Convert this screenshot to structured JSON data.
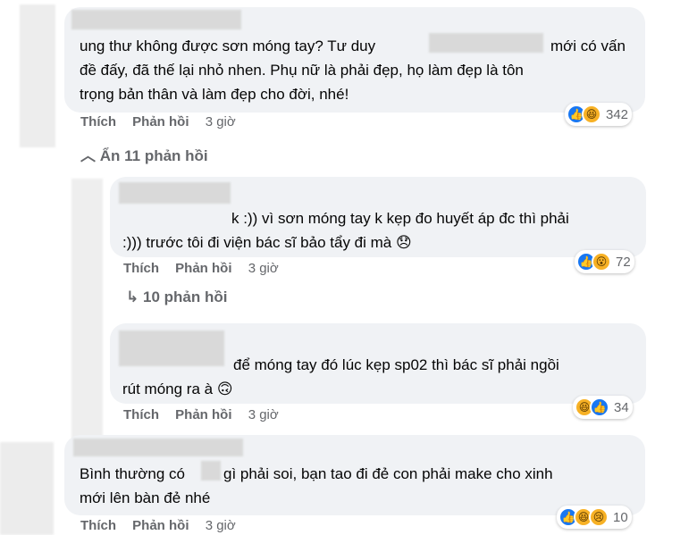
{
  "comments": [
    {
      "text_lines": [
        "ung thư không được sơn móng tay? Tư duy",
        "mới có vấn",
        "đề đấy, đã thế lại nhỏ nhen. Phụ nữ là phải đẹp, họ làm đẹp là tôn",
        "trọng bản thân và làm đẹp cho đời, nhé!"
      ],
      "like_label": "Thích",
      "reply_label": "Phản hồi",
      "time": "3 giờ",
      "reaction_count": "342",
      "reactions": [
        "like-icon",
        "haha-icon"
      ]
    },
    {
      "text_lines": [
        "k :)) vì sơn móng tay k kẹp đo huyết áp đc thì phải",
        ":))) trước tôi đi viện bác sĩ bảo tẩy đi mà 😞"
      ],
      "like_label": "Thích",
      "reply_label": "Phản hồi",
      "time": "3 giờ",
      "reaction_count": "72",
      "reactions": [
        "like-icon",
        "wow-icon"
      ]
    },
    {
      "text_lines": [
        "để móng tay đó lúc kẹp sp02 thì bác sĩ phải ngồi",
        "rút móng ra à 🙃"
      ],
      "like_label": "Thích",
      "reply_label": "Phản hồi",
      "time": "3 giờ",
      "reaction_count": "34",
      "reactions": [
        "haha-icon",
        "like-icon"
      ]
    },
    {
      "text_lines": [
        "Bình thường có",
        "gì phải soi, bạn tao đi đẻ con phải make cho xinh",
        "mới lên bàn đẻ nhé"
      ],
      "like_label": "Thích",
      "reply_label": "Phản hồi",
      "time": "3 giờ",
      "reaction_count": "10",
      "reactions": [
        "like-icon",
        "haha-icon",
        "sad-icon"
      ]
    }
  ],
  "hide_replies": "Ẩn 11 phản hồi",
  "more_replies": "10 phản hồi"
}
